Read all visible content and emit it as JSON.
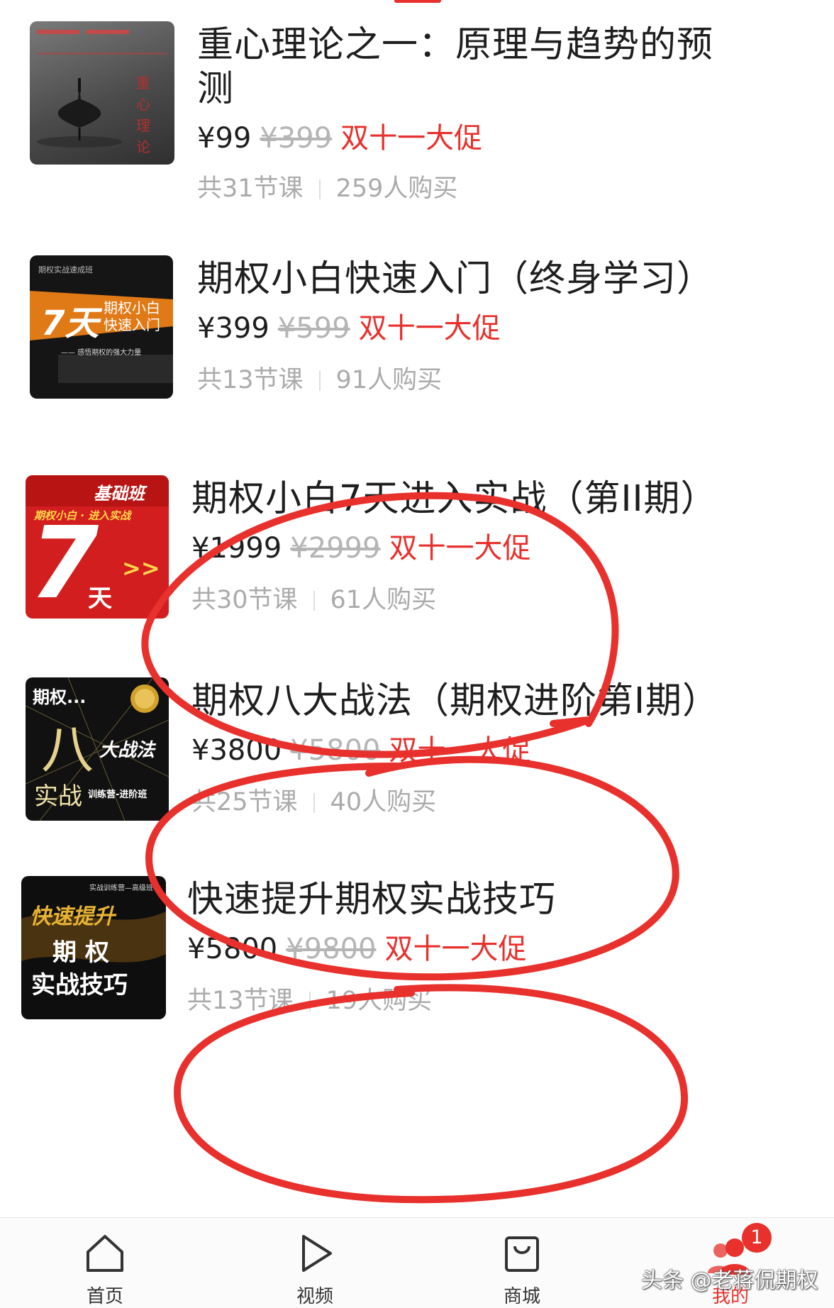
{
  "courses": [
    {
      "title_line1": "重心理论之一：原理与趋势的预",
      "title_line2": "测",
      "price": "¥99",
      "original_price": "¥399",
      "promo": "双十一大促",
      "lessons": "共31节课",
      "buyers": "259人购买",
      "thumb_text": "重心理论"
    },
    {
      "title_line1": "期权小白快速入门（终身学习）",
      "price": "¥399",
      "original_price": "¥599",
      "promo": "双十一大促",
      "lessons": "共13节课",
      "buyers": "91人购买",
      "thumb_top": "期权实战速成班",
      "thumb_big": "7天",
      "thumb_side_1": "期权小白",
      "thumb_side_2": "快速入门",
      "thumb_bottom": "—— 感悟期权的强大力量"
    },
    {
      "title_line1": "期权小白7天进入实战（第II期）",
      "price": "¥1999",
      "original_price": "¥2999",
      "promo": "双十一大促",
      "lessons": "共30节课",
      "buyers": "61人购买",
      "thumb_tag": "基础班",
      "thumb_sub": "期权小白 · 进入实战",
      "thumb_big": "7",
      "thumb_small": "天",
      "thumb_arrows": ">>"
    },
    {
      "title_line1": "期权八大战法（期权进阶第I期）",
      "price": "¥3800",
      "original_price": "¥5800",
      "promo": "双十一大促",
      "lessons": "共25节课",
      "buyers": "40人购买",
      "thumb_top": "期权...",
      "thumb_big": "八",
      "thumb_mid": "大战法",
      "thumb_bottom": "实战",
      "thumb_tag": "训练营-进阶班"
    },
    {
      "title_line1": "快速提升期权实战技巧",
      "price": "¥5800",
      "original_price": "¥9800",
      "promo": "双十一大促",
      "lessons": "共13节课",
      "buyers": "19人购买",
      "thumb_top": "实战训练营—高级班",
      "thumb_line1": "快速提升",
      "thumb_line2": "期 权",
      "thumb_line3": "实战技巧"
    }
  ],
  "nav": {
    "items": [
      {
        "label": "首页",
        "icon": "home-icon"
      },
      {
        "label": "视频",
        "icon": "play-icon"
      },
      {
        "label": "商城",
        "icon": "shopping-bag-icon"
      },
      {
        "label": "我的",
        "icon": "user-group-icon"
      }
    ],
    "badge": "1"
  },
  "watermark": "头条 @老蒋侃期权",
  "colors": {
    "accent": "#e8302c",
    "text": "#1e1e1e",
    "muted": "#ababab"
  }
}
